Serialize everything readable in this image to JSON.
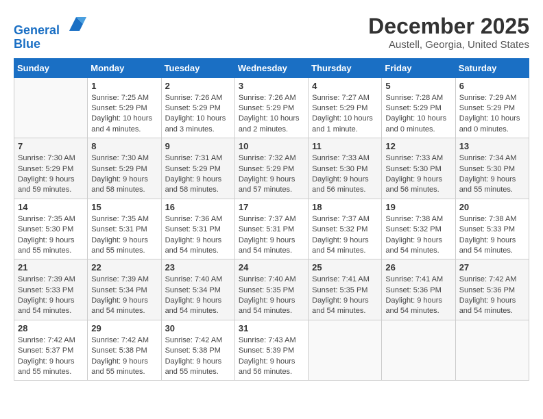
{
  "header": {
    "logo_line1": "General",
    "logo_line2": "Blue",
    "month_title": "December 2025",
    "location": "Austell, Georgia, United States"
  },
  "weekdays": [
    "Sunday",
    "Monday",
    "Tuesday",
    "Wednesday",
    "Thursday",
    "Friday",
    "Saturday"
  ],
  "weeks": [
    [
      {
        "day": "",
        "info": ""
      },
      {
        "day": "1",
        "info": "Sunrise: 7:25 AM\nSunset: 5:29 PM\nDaylight: 10 hours\nand 4 minutes."
      },
      {
        "day": "2",
        "info": "Sunrise: 7:26 AM\nSunset: 5:29 PM\nDaylight: 10 hours\nand 3 minutes."
      },
      {
        "day": "3",
        "info": "Sunrise: 7:26 AM\nSunset: 5:29 PM\nDaylight: 10 hours\nand 2 minutes."
      },
      {
        "day": "4",
        "info": "Sunrise: 7:27 AM\nSunset: 5:29 PM\nDaylight: 10 hours\nand 1 minute."
      },
      {
        "day": "5",
        "info": "Sunrise: 7:28 AM\nSunset: 5:29 PM\nDaylight: 10 hours\nand 0 minutes."
      },
      {
        "day": "6",
        "info": "Sunrise: 7:29 AM\nSunset: 5:29 PM\nDaylight: 10 hours\nand 0 minutes."
      }
    ],
    [
      {
        "day": "7",
        "info": "Sunrise: 7:30 AM\nSunset: 5:29 PM\nDaylight: 9 hours\nand 59 minutes."
      },
      {
        "day": "8",
        "info": "Sunrise: 7:30 AM\nSunset: 5:29 PM\nDaylight: 9 hours\nand 58 minutes."
      },
      {
        "day": "9",
        "info": "Sunrise: 7:31 AM\nSunset: 5:29 PM\nDaylight: 9 hours\nand 58 minutes."
      },
      {
        "day": "10",
        "info": "Sunrise: 7:32 AM\nSunset: 5:29 PM\nDaylight: 9 hours\nand 57 minutes."
      },
      {
        "day": "11",
        "info": "Sunrise: 7:33 AM\nSunset: 5:30 PM\nDaylight: 9 hours\nand 56 minutes."
      },
      {
        "day": "12",
        "info": "Sunrise: 7:33 AM\nSunset: 5:30 PM\nDaylight: 9 hours\nand 56 minutes."
      },
      {
        "day": "13",
        "info": "Sunrise: 7:34 AM\nSunset: 5:30 PM\nDaylight: 9 hours\nand 55 minutes."
      }
    ],
    [
      {
        "day": "14",
        "info": "Sunrise: 7:35 AM\nSunset: 5:30 PM\nDaylight: 9 hours\nand 55 minutes."
      },
      {
        "day": "15",
        "info": "Sunrise: 7:35 AM\nSunset: 5:31 PM\nDaylight: 9 hours\nand 55 minutes."
      },
      {
        "day": "16",
        "info": "Sunrise: 7:36 AM\nSunset: 5:31 PM\nDaylight: 9 hours\nand 54 minutes."
      },
      {
        "day": "17",
        "info": "Sunrise: 7:37 AM\nSunset: 5:31 PM\nDaylight: 9 hours\nand 54 minutes."
      },
      {
        "day": "18",
        "info": "Sunrise: 7:37 AM\nSunset: 5:32 PM\nDaylight: 9 hours\nand 54 minutes."
      },
      {
        "day": "19",
        "info": "Sunrise: 7:38 AM\nSunset: 5:32 PM\nDaylight: 9 hours\nand 54 minutes."
      },
      {
        "day": "20",
        "info": "Sunrise: 7:38 AM\nSunset: 5:33 PM\nDaylight: 9 hours\nand 54 minutes."
      }
    ],
    [
      {
        "day": "21",
        "info": "Sunrise: 7:39 AM\nSunset: 5:33 PM\nDaylight: 9 hours\nand 54 minutes."
      },
      {
        "day": "22",
        "info": "Sunrise: 7:39 AM\nSunset: 5:34 PM\nDaylight: 9 hours\nand 54 minutes."
      },
      {
        "day": "23",
        "info": "Sunrise: 7:40 AM\nSunset: 5:34 PM\nDaylight: 9 hours\nand 54 minutes."
      },
      {
        "day": "24",
        "info": "Sunrise: 7:40 AM\nSunset: 5:35 PM\nDaylight: 9 hours\nand 54 minutes."
      },
      {
        "day": "25",
        "info": "Sunrise: 7:41 AM\nSunset: 5:35 PM\nDaylight: 9 hours\nand 54 minutes."
      },
      {
        "day": "26",
        "info": "Sunrise: 7:41 AM\nSunset: 5:36 PM\nDaylight: 9 hours\nand 54 minutes."
      },
      {
        "day": "27",
        "info": "Sunrise: 7:42 AM\nSunset: 5:36 PM\nDaylight: 9 hours\nand 54 minutes."
      }
    ],
    [
      {
        "day": "28",
        "info": "Sunrise: 7:42 AM\nSunset: 5:37 PM\nDaylight: 9 hours\nand 55 minutes."
      },
      {
        "day": "29",
        "info": "Sunrise: 7:42 AM\nSunset: 5:38 PM\nDaylight: 9 hours\nand 55 minutes."
      },
      {
        "day": "30",
        "info": "Sunrise: 7:42 AM\nSunset: 5:38 PM\nDaylight: 9 hours\nand 55 minutes."
      },
      {
        "day": "31",
        "info": "Sunrise: 7:43 AM\nSunset: 5:39 PM\nDaylight: 9 hours\nand 56 minutes."
      },
      {
        "day": "",
        "info": ""
      },
      {
        "day": "",
        "info": ""
      },
      {
        "day": "",
        "info": ""
      }
    ]
  ]
}
